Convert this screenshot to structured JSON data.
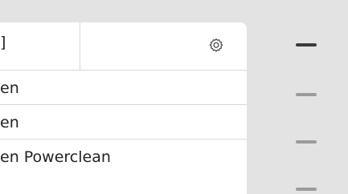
{
  "header": {
    "left_text": "]",
    "gear_icon": "gear-icon"
  },
  "list": {
    "rows": [
      {
        "label": "en"
      },
      {
        "label": "en"
      },
      {
        "label": "en Powerclean"
      }
    ]
  },
  "right_pane": {
    "handles": [
      {
        "state": "active"
      },
      {
        "state": "inactive"
      },
      {
        "state": "inactive"
      },
      {
        "state": "inactive"
      }
    ]
  }
}
